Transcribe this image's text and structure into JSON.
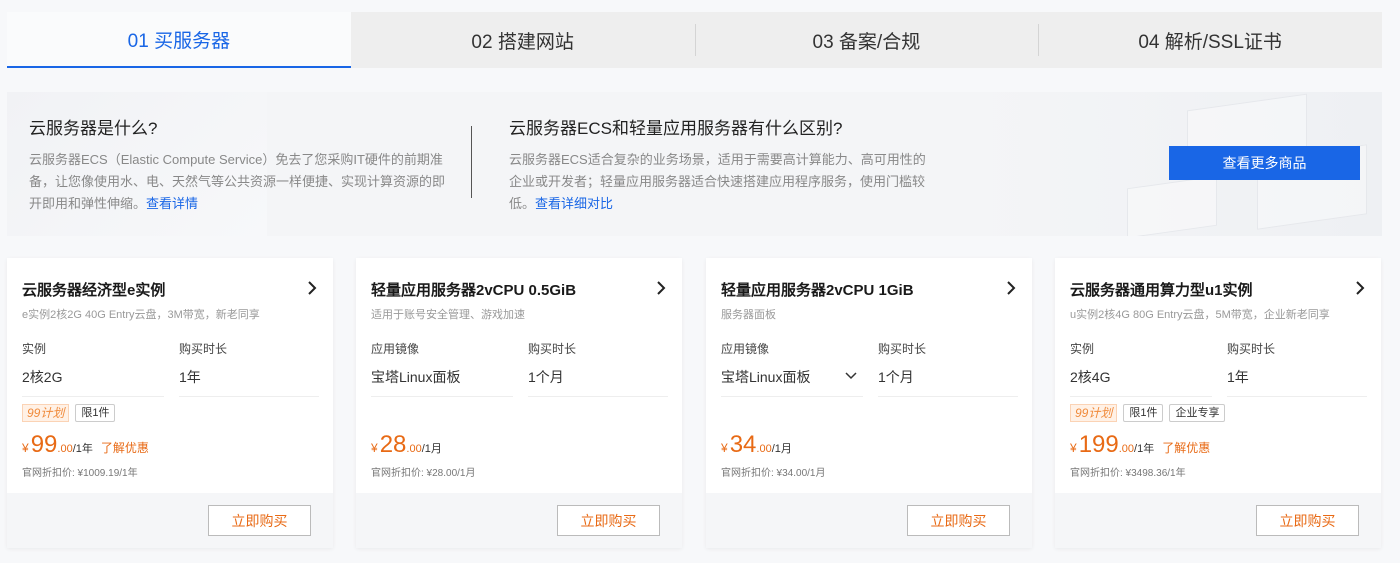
{
  "tabs": [
    {
      "label": "01 买服务器",
      "active": true
    },
    {
      "label": "02 搭建网站",
      "active": false
    },
    {
      "label": "03 备案/合规",
      "active": false
    },
    {
      "label": "04 解析/SSL证书",
      "active": false
    }
  ],
  "intro": {
    "left": {
      "title": "云服务器是什么?",
      "text": "云服务器ECS（Elastic Compute Service）免去了您采购IT硬件的前期准备，让您像使用水、电、天然气等公共资源一样便捷、实现计算资源的即开即用和弹性伸缩。",
      "link": "查看详情"
    },
    "mid": {
      "title": "云服务器ECS和轻量应用服务器有什么区别?",
      "text": "云服务器ECS适合复杂的业务场景，适用于需要高计算能力、高可用性的企业或开发者；轻量应用服务器适合快速搭建应用程序服务，使用门槛较低。",
      "link": "查看详细对比"
    },
    "more_button": "查看更多商品"
  },
  "accent_color": "#1966e6",
  "price_color": "#e86a15",
  "cards": [
    {
      "title": "云服务器经济型e实例",
      "subtitle": "e实例2核2G 40G Entry云盘，3M带宽，新老同享",
      "field1_label": "实例",
      "field1_value": "2核2G",
      "field1_dropdown": false,
      "field2_label": "购买时长",
      "field2_value": "1年",
      "tag_plan": "99计划",
      "tags": [
        "限1件"
      ],
      "currency": "¥",
      "price_int": "99",
      "price_dec": ".00",
      "price_unit": "/1年",
      "promo": "了解优惠",
      "original": "官网折扣价: ¥1009.19/1年",
      "buy": "立即购买"
    },
    {
      "title": "轻量应用服务器2vCPU 0.5GiB",
      "subtitle": "适用于账号安全管理、游戏加速",
      "field1_label": "应用镜像",
      "field1_value": "宝塔Linux面板",
      "field1_dropdown": false,
      "field2_label": "购买时长",
      "field2_value": "1个月",
      "tag_plan": "",
      "tags": [],
      "currency": "¥",
      "price_int": "28",
      "price_dec": ".00",
      "price_unit": "/1月",
      "promo": "",
      "original": "官网折扣价: ¥28.00/1月",
      "buy": "立即购买"
    },
    {
      "title": "轻量应用服务器2vCPU 1GiB",
      "subtitle": "服务器面板",
      "field1_label": "应用镜像",
      "field1_value": "宝塔Linux面板",
      "field1_dropdown": true,
      "field2_label": "购买时长",
      "field2_value": "1个月",
      "tag_plan": "",
      "tags": [],
      "currency": "¥",
      "price_int": "34",
      "price_dec": ".00",
      "price_unit": "/1月",
      "promo": "",
      "original": "官网折扣价: ¥34.00/1月",
      "buy": "立即购买"
    },
    {
      "title": "云服务器通用算力型u1实例",
      "subtitle": "u实例2核4G 80G Entry云盘，5M带宽，企业新老同享",
      "field1_label": "实例",
      "field1_value": "2核4G",
      "field1_dropdown": false,
      "field2_label": "购买时长",
      "field2_value": "1年",
      "tag_plan": "99计划",
      "tags": [
        "限1件",
        "企业专享"
      ],
      "currency": "¥",
      "price_int": "199",
      "price_dec": ".00",
      "price_unit": "/1年",
      "promo": "了解优惠",
      "original": "官网折扣价: ¥3498.36/1年",
      "buy": "立即购买"
    }
  ]
}
